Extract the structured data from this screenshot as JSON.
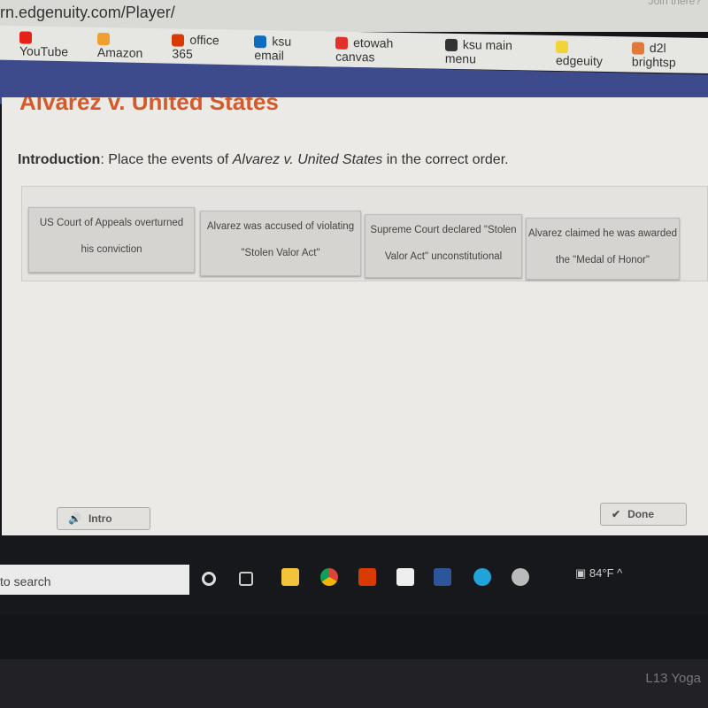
{
  "browser": {
    "url": "rn.edgenuity.com/Player/",
    "top_right_text": "Join there?",
    "bookmarks": [
      {
        "label": "YouTube",
        "icon": "youtube-icon",
        "color": "#e62117"
      },
      {
        "label": "Amazon",
        "icon": "amazon-icon",
        "color": "#f0a030"
      },
      {
        "label": "office 365",
        "icon": "office-icon",
        "color": "#d83b01"
      },
      {
        "label": "ksu email",
        "icon": "outlook-icon",
        "color": "#0f6cbd"
      },
      {
        "label": "etowah canvas",
        "icon": "canvas-icon",
        "color": "#e0322b"
      },
      {
        "label": "ksu main menu",
        "icon": "globe-icon",
        "color": "#333333"
      },
      {
        "label": "edgeuity",
        "icon": "lightbulb-icon",
        "color": "#f3d23a"
      },
      {
        "label": "d2l brightsp",
        "icon": "d2l-icon",
        "color": "#e07a3a"
      }
    ]
  },
  "lesson": {
    "title": "Alvarez v. United States",
    "intro_label": "Introduction",
    "intro_text_1": ": Place the events of ",
    "intro_case": "Alvarez v. United States",
    "intro_text_2": " in the correct order.",
    "cards": [
      {
        "line1": "US Court of Appeals overturned",
        "line2": "his conviction"
      },
      {
        "line1": "Alvarez was accused of violating",
        "line2": "\"Stolen Valor Act\""
      },
      {
        "line1": "Supreme Court declared \"Stolen",
        "line2": "Valor Act\" unconstitutional"
      },
      {
        "line1": "Alvarez claimed he was awarded",
        "line2": "the \"Medal of Honor\""
      }
    ],
    "intro_button": "Intro",
    "done_button": "Done"
  },
  "taskbar": {
    "search_placeholder": "to search",
    "temperature": "84°F"
  },
  "device_label": "L13 Yoga"
}
